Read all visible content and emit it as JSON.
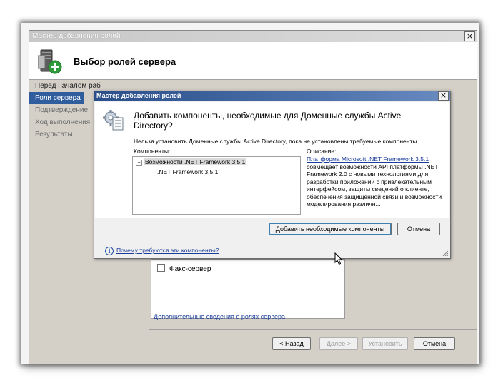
{
  "back_window": {
    "title": "Мастер добавления ролей",
    "header_title": "Выбор ролей сервера",
    "nav": [
      "Перед началом раб",
      "Роли сервера",
      "Подтверждение",
      "Ход выполнения",
      "Результаты"
    ],
    "fax_label": "Факс-сервер",
    "more_link": "Дополнительные сведения о ролях сервера",
    "buttons": {
      "back": "< Назад",
      "next": "Далее >",
      "install": "Установить",
      "cancel": "Отмена"
    }
  },
  "dialog": {
    "title": "Мастер добавления ролей",
    "heading": "Добавить компоненты, необходимые для Доменные службы Active Directory?",
    "description": "Нельзя установить Доменные службы Active Directory, пока не установлены требуемые компоненты.",
    "components_label": "Компоненты:",
    "description_label": "Описание:",
    "tree": {
      "expander": "−",
      "parent": "Возможности .NET Framework 3.5.1",
      "child": ".NET Framework 3.5.1"
    },
    "desc_link": "Платформа Microsoft .NET Framework 3.5.1",
    "desc_rest": " совмещает возможности API платформы .NET Framework 2.0 с новыми технологиями для разработки приложений с привлекательным интерфейсом, защиты сведений о клиенте, обеспечения защищенной связи и  возможности моделирования различн...",
    "add_button": "Добавить необходимые компоненты",
    "cancel_button": "Отмена",
    "why_link": "Почему требуются эти компоненты?"
  },
  "colors": {
    "selected_nav": "#2f5d9e",
    "dialog_titlebar": "#2a4f8a",
    "link": "#1a3c9a"
  },
  "icons": [
    "server-roles-icon",
    "components-gear-icon",
    "info-icon",
    "close-icon",
    "mouse-cursor-icon"
  ]
}
